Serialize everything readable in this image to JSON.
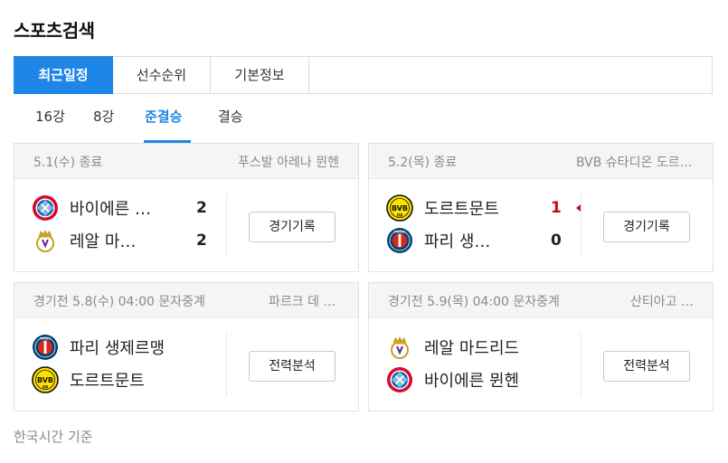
{
  "title": "스포츠검색",
  "tabs": [
    {
      "label": "최근일정",
      "active": true
    },
    {
      "label": "선수순위",
      "active": false
    },
    {
      "label": "기본정보",
      "active": false
    }
  ],
  "subtabs": [
    {
      "label": "16강",
      "active": false
    },
    {
      "label": "8강",
      "active": false
    },
    {
      "label": "준결승",
      "active": true
    },
    {
      "label": "결승",
      "active": false
    }
  ],
  "colors": {
    "accent": "#1d86e6",
    "winner": "#d0021b",
    "muted": "#8a8a8a"
  },
  "matches": [
    {
      "info": "5.1(수) 종료",
      "venue": "푸스발 아레나 뮌헨",
      "home": {
        "name": "바이에른 뮌헨",
        "logo": "bayern-logo-icon",
        "score": "2"
      },
      "away": {
        "name": "레알 마드리드",
        "logo": "real-madrid-logo-icon",
        "score": "2"
      },
      "button": "경기기록"
    },
    {
      "info": "5.2(목) 종료",
      "venue": "BVB 슈타디온 도르트문트",
      "home": {
        "name": "도르트문트",
        "logo": "dortmund-logo-icon",
        "score": "1",
        "winner": true
      },
      "away": {
        "name": "파리 생제르맹",
        "logo": "psg-logo-icon",
        "score": "0"
      },
      "button": "경기기록"
    },
    {
      "info": "경기전 5.8(수) 04:00 문자중계",
      "venue": "파르크 데 프랭스",
      "home": {
        "name": "파리 생제르맹",
        "logo": "psg-logo-icon"
      },
      "away": {
        "name": "도르트문트",
        "logo": "dortmund-logo-icon"
      },
      "button": "전력분석"
    },
    {
      "info": "경기전 5.9(목) 04:00 문자중계",
      "venue": "산티아고 베르나베우",
      "home": {
        "name": "레알 마드리드",
        "logo": "real-madrid-logo-icon"
      },
      "away": {
        "name": "바이에른 뮌헨",
        "logo": "bayern-logo-icon"
      },
      "button": "전력분석"
    }
  ],
  "footer": "한국시간 기준"
}
